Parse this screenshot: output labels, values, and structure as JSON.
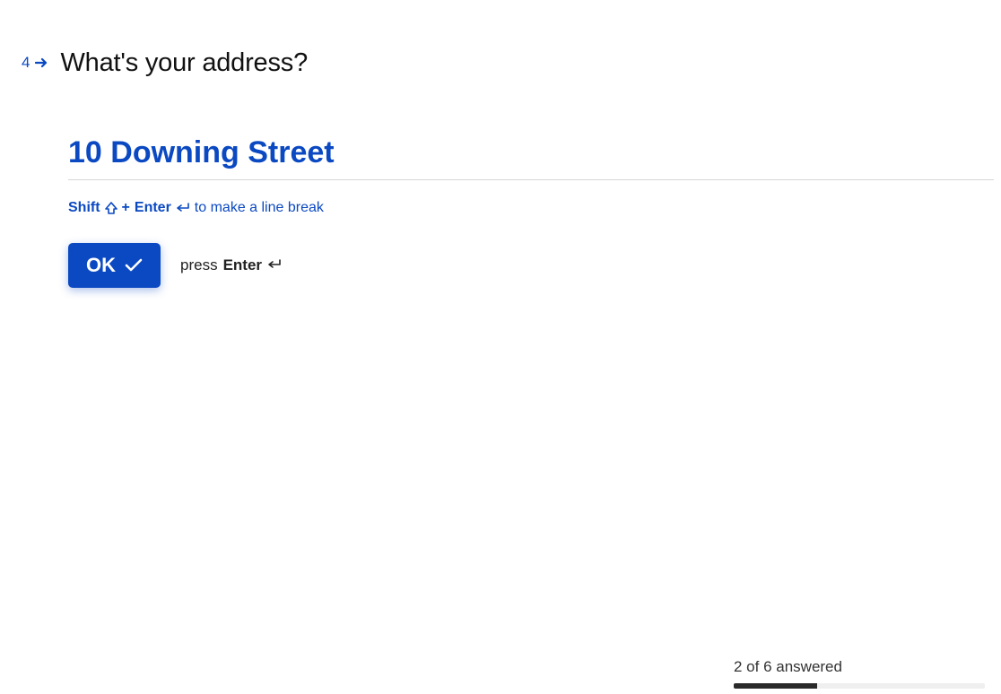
{
  "question": {
    "number": "4",
    "title": "What's your address?",
    "answer": "10 Downing Street"
  },
  "hint": {
    "shift_label": "Shift",
    "plus": "+",
    "enter_label": "Enter",
    "rest": "to make a line break"
  },
  "action": {
    "ok_label": "OK",
    "press_prefix": "press",
    "press_key": "Enter"
  },
  "progress": {
    "answered": 2,
    "total": 6,
    "label": "2 of 6 answered",
    "percent": "33.33%"
  },
  "colors": {
    "accent": "#0b49c2"
  }
}
